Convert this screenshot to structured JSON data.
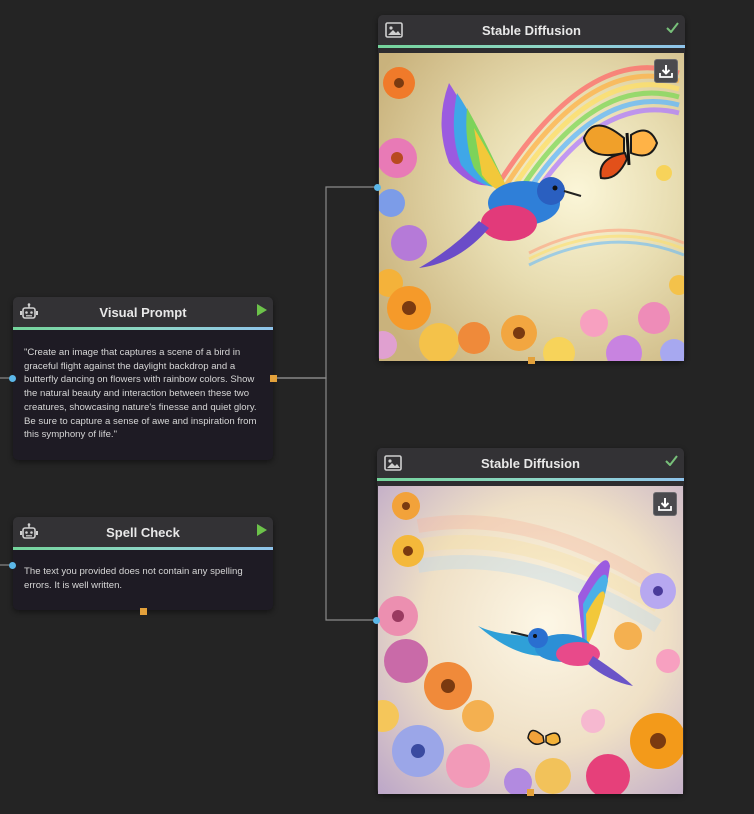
{
  "nodes": {
    "visual_prompt": {
      "title": "Visual Prompt",
      "icon": "robot-icon",
      "action_icon": "play-icon",
      "body": "\"Create an image that captures a scene of a bird in graceful flight against the daylight backdrop and a butterfly dancing on flowers with rainbow colors. Show the natural beauty and interaction between these two creatures, showcasing nature's finesse and quiet glory. Be sure to capture a sense of awe and inspiration from this symphony of life.\""
    },
    "spell_check": {
      "title": "Spell Check",
      "icon": "robot-icon",
      "action_icon": "play-icon",
      "body": "The text you provided does not contain any spelling errors. It is well written."
    },
    "stable_diffusion_1": {
      "title": "Stable Diffusion",
      "icon": "image-icon",
      "status_icon": "checkmark-icon",
      "image": "hummingbird and butterfly in rainbow flower meadow",
      "action_icon": "download-icon"
    },
    "stable_diffusion_2": {
      "title": "Stable Diffusion",
      "icon": "image-icon",
      "status_icon": "checkmark-icon",
      "image": "hummingbird over colorful wildflowers",
      "action_icon": "download-icon"
    }
  },
  "colors": {
    "canvas": "#242424",
    "input_port": "#5bb7e8",
    "output_port": "#e3a13b",
    "accent_green": "#74d49b",
    "accent_blue": "#8fc4ec",
    "play_green": "#6cc24a",
    "check_green": "#78c07a"
  }
}
